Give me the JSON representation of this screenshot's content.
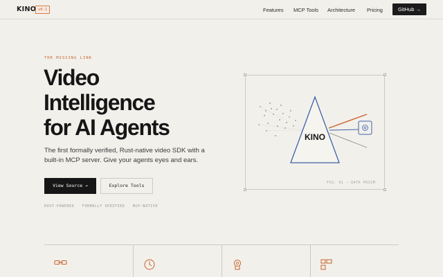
{
  "nav": {
    "logo": "KINO",
    "version": "v0.1",
    "links": [
      "Features",
      "MCP Tools",
      "Architecture",
      "Pricing"
    ],
    "cta": "GitHub →"
  },
  "hero": {
    "eyebrow": "THE MISSING LINK",
    "title_lines": [
      "Video",
      "Intelligence",
      "for AI Agents"
    ],
    "subtitle": "The first formally verified, Rust-native video SDK with a built-in MCP server. Give your agents eyes and ears.",
    "primary_button": "View Source →",
    "secondary_button": "Explore Tools",
    "tags": [
      "RUST-POWERED",
      "FORMALLY VERIFIED",
      "MCP-NATIVE"
    ]
  },
  "figure": {
    "prism_label": "KINO",
    "caption": "FIG. 01 — DATA PRISM"
  },
  "features": {
    "icons": [
      "link-icon",
      "clock-icon",
      "badge-icon",
      "blocks-icon"
    ]
  },
  "colors": {
    "accent": "#c8612a",
    "ink": "#161616",
    "background": "#f2f0eb",
    "prism_blue": "#3d63a8"
  }
}
